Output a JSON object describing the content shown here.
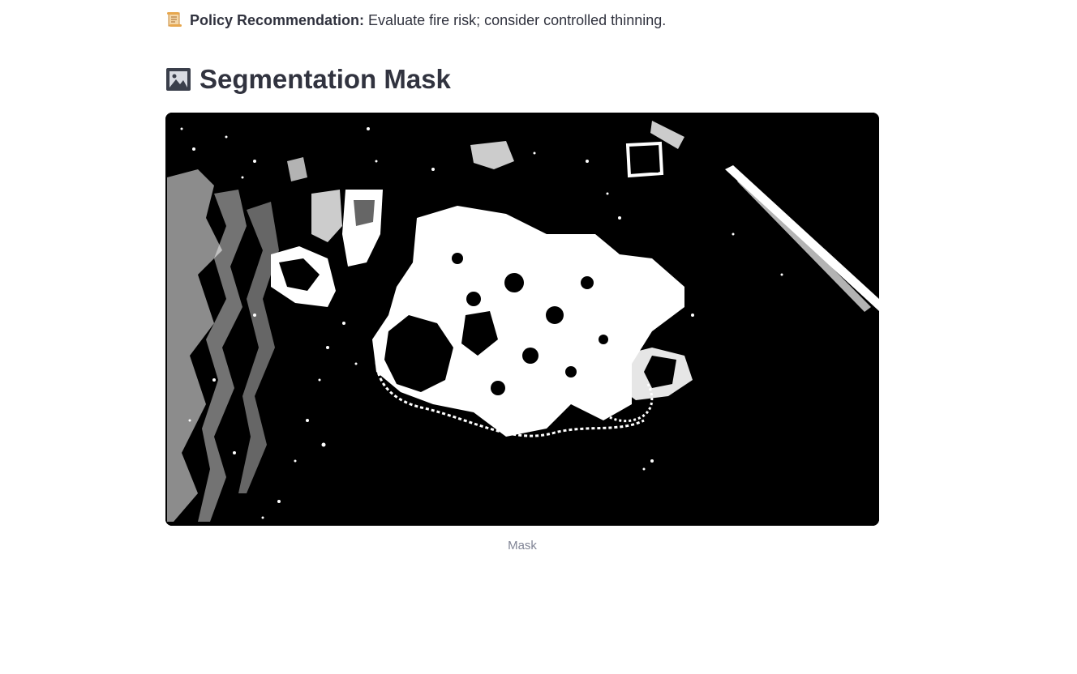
{
  "policy": {
    "icon": "scroll-icon",
    "label": "Policy Recommendation:",
    "text": " Evaluate fire risk; consider controlled thinning."
  },
  "section": {
    "icon": "framed-picture-icon",
    "title": "Segmentation Mask"
  },
  "image": {
    "alt": "Mask",
    "caption": "Mask",
    "background": "#000000",
    "foreground": "#ffffff"
  },
  "colors": {
    "text": "#31333f",
    "caption": "#808495"
  }
}
